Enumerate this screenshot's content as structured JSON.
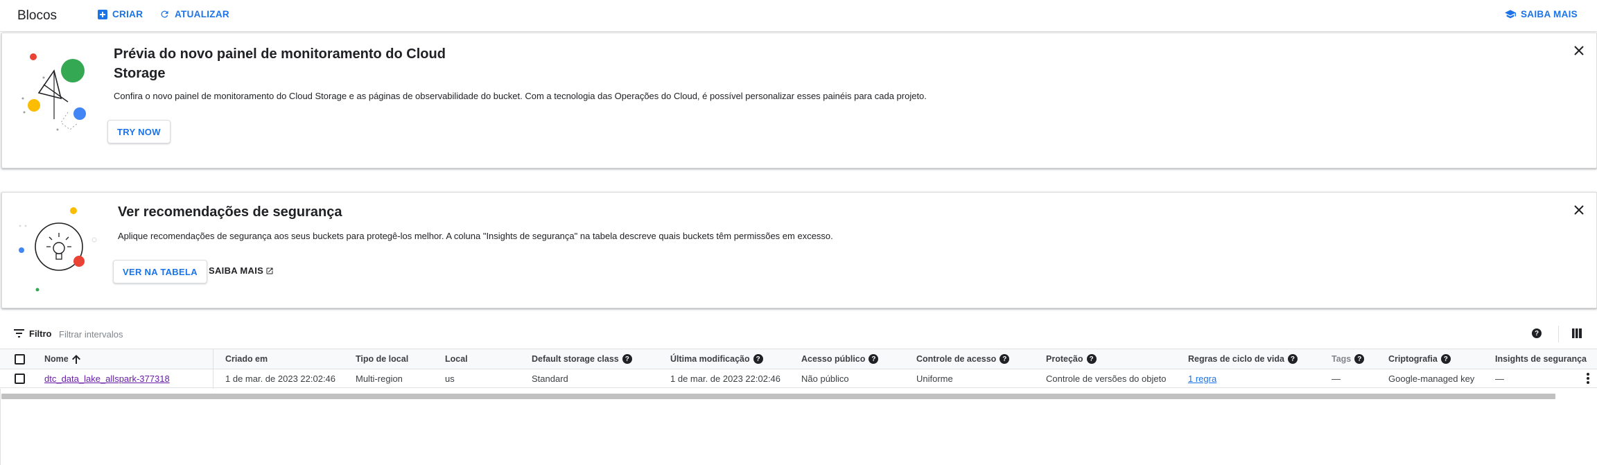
{
  "header": {
    "title": "Blocos",
    "create_label": "CRIAR",
    "refresh_label": "ATUALIZAR",
    "learn_more_label": "SAIBA MAIS"
  },
  "monitoring_banner": {
    "title": "Prévia do novo painel de monitoramento do Cloud Storage",
    "description": "Confira o novo painel de monitoramento do Cloud Storage e as páginas de observabilidade do bucket. Com a tecnologia das Operações do Cloud, é possível personalizar esses painéis para cada projeto.",
    "try_label": "TRY NOW"
  },
  "security_banner": {
    "title": "Ver recomendações de segurança",
    "description": "Aplique recomendações de segurança aos seus buckets para protegê-los melhor. A coluna \"Insights de segurança\" na tabela descreve quais buckets têm permissões em excesso.",
    "view_table_label": "VER NA TABELA",
    "learn_more_label": "SAIBA MAIS"
  },
  "filter": {
    "label": "Filtro",
    "placeholder": "Filtrar intervalos"
  },
  "table": {
    "columns": {
      "name": "Nome",
      "created": "Criado em",
      "location_type": "Tipo de local",
      "location": "Local",
      "storage_class": "Default storage class",
      "modified": "Última modificação",
      "public_access": "Acesso público",
      "access_control": "Controle de acesso",
      "protection": "Proteção",
      "lifecycle": "Regras de ciclo de vida",
      "tags": "Tags",
      "encryption": "Criptografia",
      "insights": "Insights de segurança"
    },
    "rows": [
      {
        "name": "dtc_data_lake_allspark-377318",
        "created": "1 de mar. de 2023 22:02:46",
        "location_type": "Multi-region",
        "location": "us",
        "storage_class": "Standard",
        "modified": "1 de mar. de 2023 22:02:46",
        "public_access": "Não público",
        "access_control": "Uniforme",
        "protection": "Controle de versões do objeto",
        "lifecycle": "1 regra",
        "tags": "—",
        "encryption": "Google-managed key",
        "insights": "—"
      }
    ]
  },
  "help_glyph": "?",
  "colors": {
    "accent": "#1a73e8",
    "visited_link": "#681da8",
    "google_red": "#ea4335",
    "google_green": "#34a853",
    "google_yellow": "#fbbc04",
    "google_blue": "#4285f4"
  },
  "icons": [
    "add-box-icon",
    "refresh-icon",
    "school-icon",
    "close-icon",
    "open-in-new-icon",
    "filter-icon",
    "help-icon",
    "columns-icon",
    "sort-arrow-up-icon",
    "more-vert-icon"
  ]
}
